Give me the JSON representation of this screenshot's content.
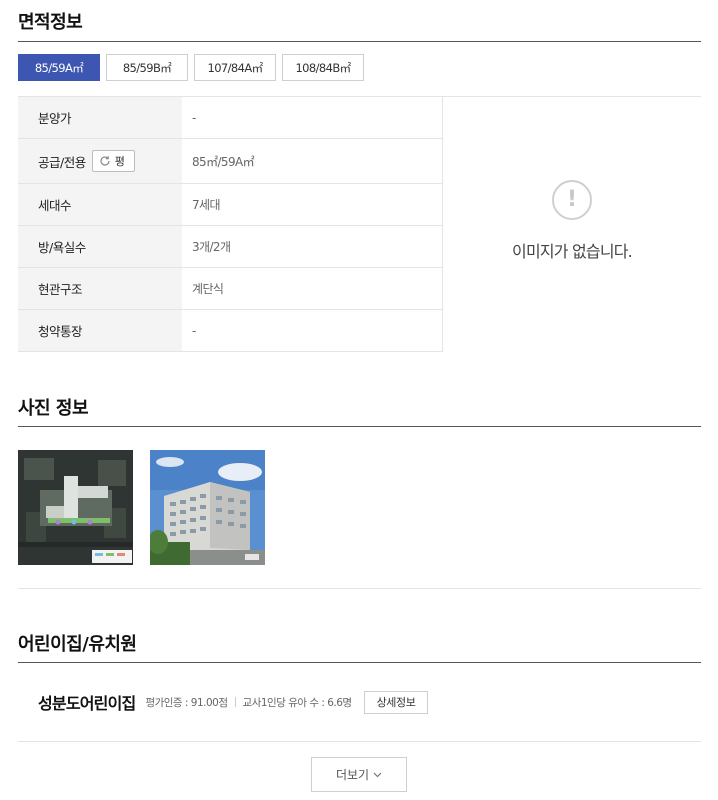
{
  "area_section": {
    "title": "면적정보",
    "tabs": [
      {
        "label": "85/59A㎡",
        "active": true
      },
      {
        "label": "85/59B㎡",
        "active": false
      },
      {
        "label": "107/84A㎡",
        "active": false
      },
      {
        "label": "108/84B㎡",
        "active": false
      }
    ],
    "rows": [
      {
        "label": "분양가",
        "value": "-"
      },
      {
        "label": "공급/전용",
        "value": "85㎡/59A㎡",
        "button": "평"
      },
      {
        "label": "세대수",
        "value": "7세대"
      },
      {
        "label": "방/욕실수",
        "value": "3개/2개"
      },
      {
        "label": "현관구조",
        "value": "계단식"
      },
      {
        "label": "청약통장",
        "value": "-"
      }
    ],
    "no_image": {
      "icon": "exclamation-icon",
      "text": "이미지가 없습니다."
    }
  },
  "photo_section": {
    "title": "사진 정보",
    "photos": [
      "site-plan-photo",
      "building-rendering-photo"
    ]
  },
  "daycare_section": {
    "title": "어린이집/유치원",
    "item": {
      "name": "성분도어린이집",
      "rating": "평가인증 : 91.00점",
      "ratio": "교사1인당 유아 수 : 6.6명",
      "detail_button": "상세정보"
    }
  },
  "more_button": {
    "label": "더보기",
    "icon": "chevron-down-icon"
  },
  "colors": {
    "accent": "#3d56b2",
    "row_header_bg": "#f4f4f4",
    "border": "#e4e4e4"
  }
}
